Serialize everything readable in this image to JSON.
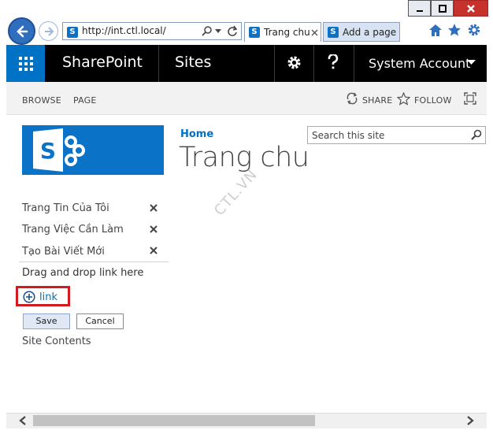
{
  "browser": {
    "url": "http://int.ctl.local/",
    "tabs": [
      {
        "label": "Trang chu",
        "active": true
      },
      {
        "label": "Add a page",
        "active": false
      }
    ]
  },
  "suite_bar": {
    "product": "SharePoint",
    "section": "Sites",
    "user": "System Account"
  },
  "ribbon": {
    "tabs": [
      "BROWSE",
      "PAGE"
    ],
    "share": "SHARE",
    "follow": "FOLLOW"
  },
  "search": {
    "placeholder": "Search this site"
  },
  "breadcrumb": "Home",
  "page_title": "Trang chu",
  "watermark": "CTL.VN",
  "quick_launch": {
    "items": [
      {
        "label": "Trang Tin Của Tôi"
      },
      {
        "label": "Trang Việc Cần Làm"
      },
      {
        "label": "Tạo Bài Viết Mới"
      }
    ],
    "drop_hint": "Drag and drop link here",
    "add_link": "link",
    "save": "Save",
    "cancel": "Cancel",
    "site_contents": "Site Contents"
  },
  "colors": {
    "accent": "#0072c6",
    "highlight": "#d01c1f",
    "suite_bar": "#000000"
  }
}
